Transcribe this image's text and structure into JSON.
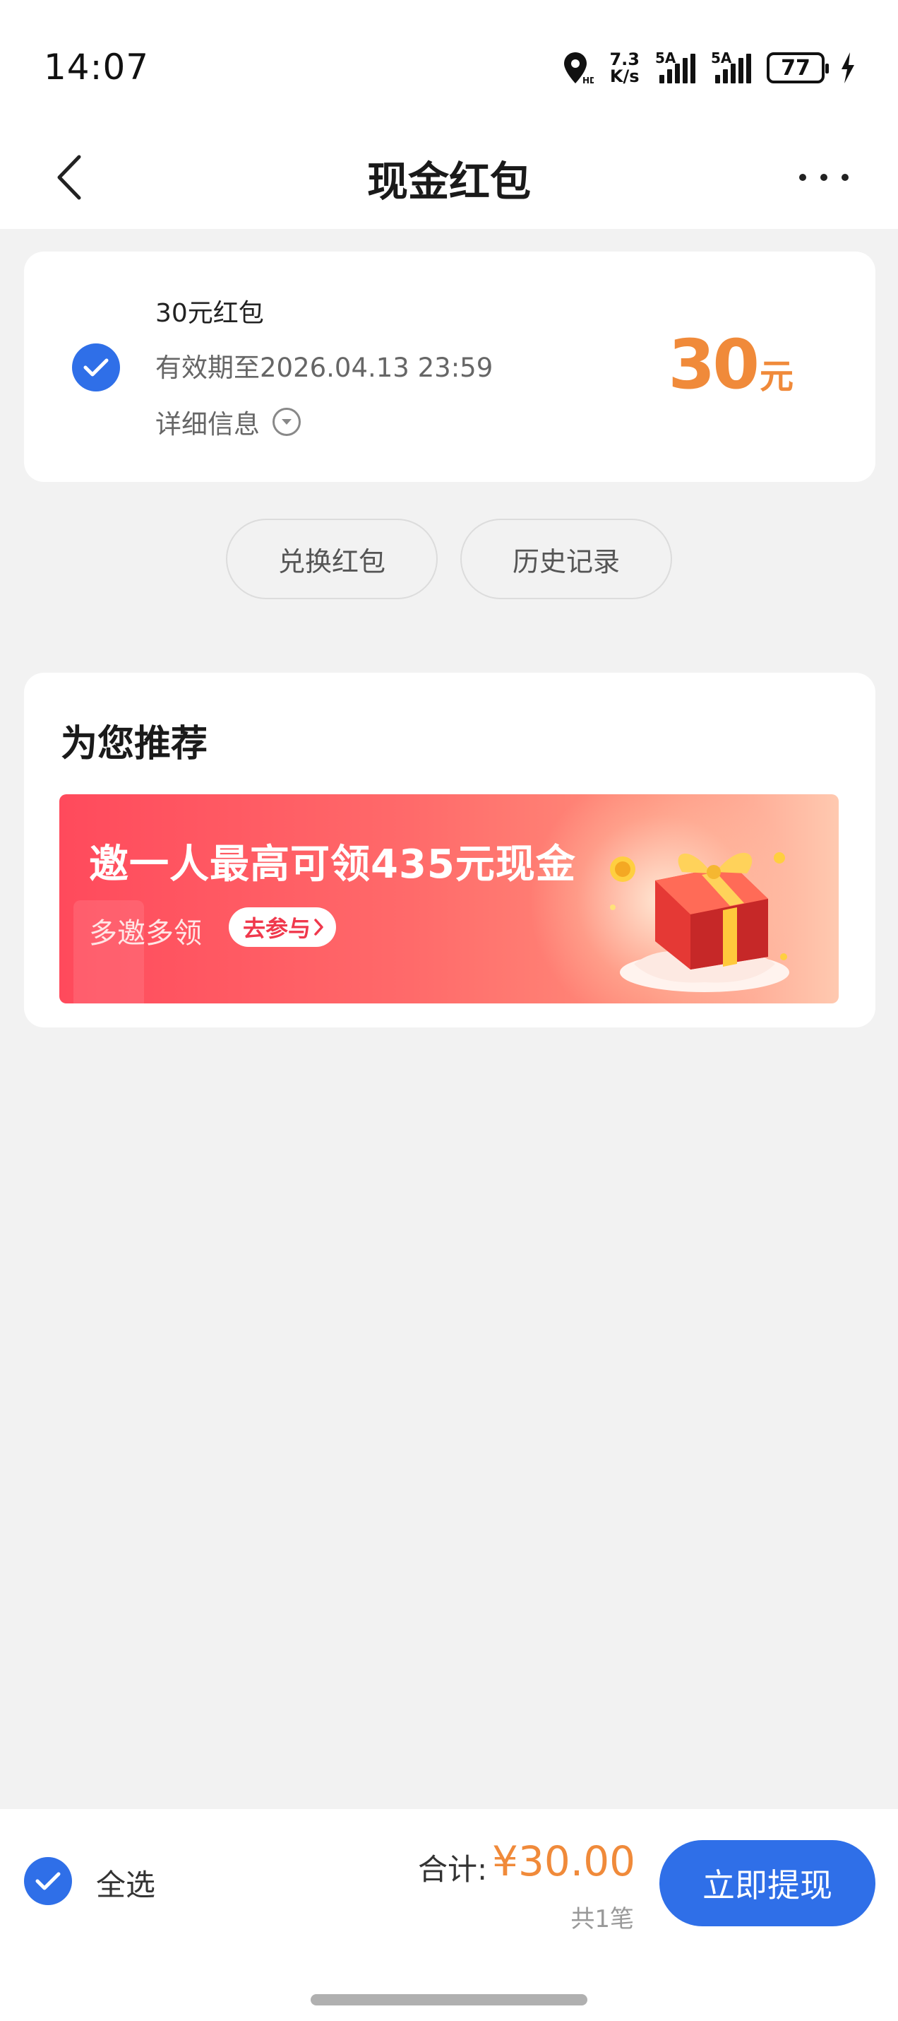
{
  "status_bar": {
    "time": "14:07",
    "net_speed_value": "7.3",
    "net_speed_unit": "K/s",
    "sim1_tag": "5A",
    "sim2_tag": "5A",
    "battery": "77"
  },
  "header": {
    "title": "现金红包"
  },
  "packet": {
    "name": "30元红包",
    "expiry": "有效期至2026.04.13 23:59",
    "detail_label": "详细信息",
    "amount": "30",
    "amount_unit": "元",
    "selected": true
  },
  "actions": {
    "exchange_label": "兑换红包",
    "history_label": "历史记录"
  },
  "recommend": {
    "title": "为您推荐",
    "banner_headline": "邀一人最高可领435元现金",
    "banner_sub": "多邀多领",
    "banner_cta": "去参与"
  },
  "footer": {
    "select_all_label": "全选",
    "total_label": "合计:",
    "total_value": "¥30.00",
    "total_count": "共1笔",
    "withdraw_label": "立即提现"
  },
  "colors": {
    "accent_blue": "#2f6fe8",
    "amount_orange": "#f08a3a",
    "banner_red": "#ff4a5c"
  }
}
